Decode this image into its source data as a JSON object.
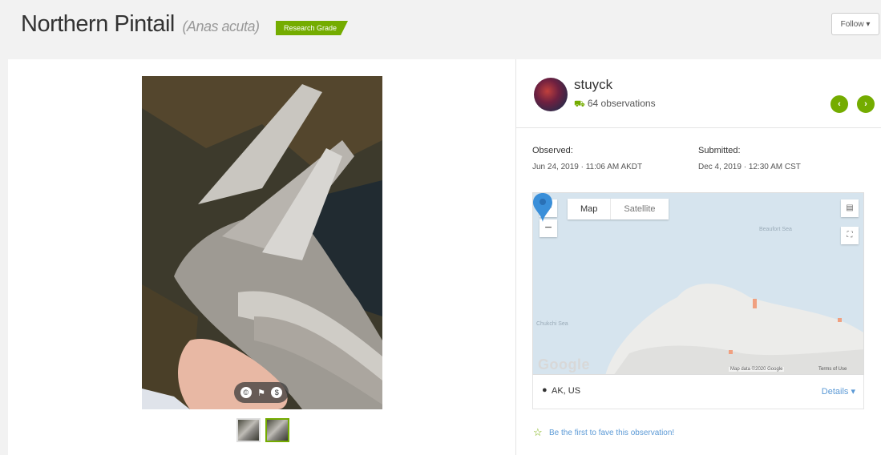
{
  "header": {
    "common_name": "Northern Pintail",
    "scientific_name": "(Anas acuta)",
    "quality_badge": "Research Grade",
    "follow_label": "Follow ▾"
  },
  "photo": {
    "controls": {
      "cc_icon": "copyright-icon",
      "flag_icon": "flag-icon",
      "license_icon": "license-icon"
    },
    "thumbnails": 2,
    "selected_thumbnail": 2
  },
  "observer": {
    "username": "stuyck",
    "observation_count": "64 observations",
    "count_icon": "binoculars-icon"
  },
  "navigation": {
    "prev_icon": "chevron-left-icon",
    "next_icon": "chevron-right-icon"
  },
  "dates": {
    "observed_label": "Observed:",
    "observed_value": "Jun 24, 2019 · 11:06 AM AKDT",
    "submitted_label": "Submitted:",
    "submitted_value": "Dec 4, 2019 · 12:30 AM CST"
  },
  "map": {
    "zoom_in": "+",
    "zoom_out": "−",
    "type_map": "Map",
    "type_satellite": "Satellite",
    "selected_type": "Map",
    "sea_label_1": "Beaufort Sea",
    "sea_label_2": "Chukchi Sea",
    "google_logo": "Google",
    "attribution": "Map data ©2020 Google",
    "terms": "Terms of Use",
    "marker_color": "#3a8fd9"
  },
  "place": {
    "text": "AK, US",
    "details_label": "Details ▾"
  },
  "fave": {
    "text": "Be the first to fave this observation!"
  },
  "colors": {
    "accent_green": "#74ac00",
    "link_blue": "#5c9ad6"
  }
}
